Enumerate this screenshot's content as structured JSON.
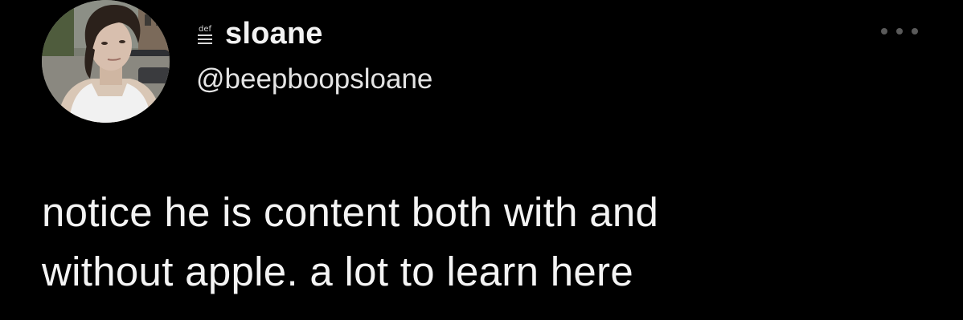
{
  "author": {
    "display_name": "sloane",
    "handle": "@beepboopsloane",
    "name_icon": "def-underline-icon",
    "avatar": "profile-photo"
  },
  "tweet": {
    "text": "notice he is content both with and\nwithout apple. a lot to learn here"
  },
  "menu": {
    "icon": "more-horizontal-icon"
  },
  "colors": {
    "background": "#000000",
    "text": "#f4f4f4",
    "menu_dots": "#5a5a5a"
  }
}
